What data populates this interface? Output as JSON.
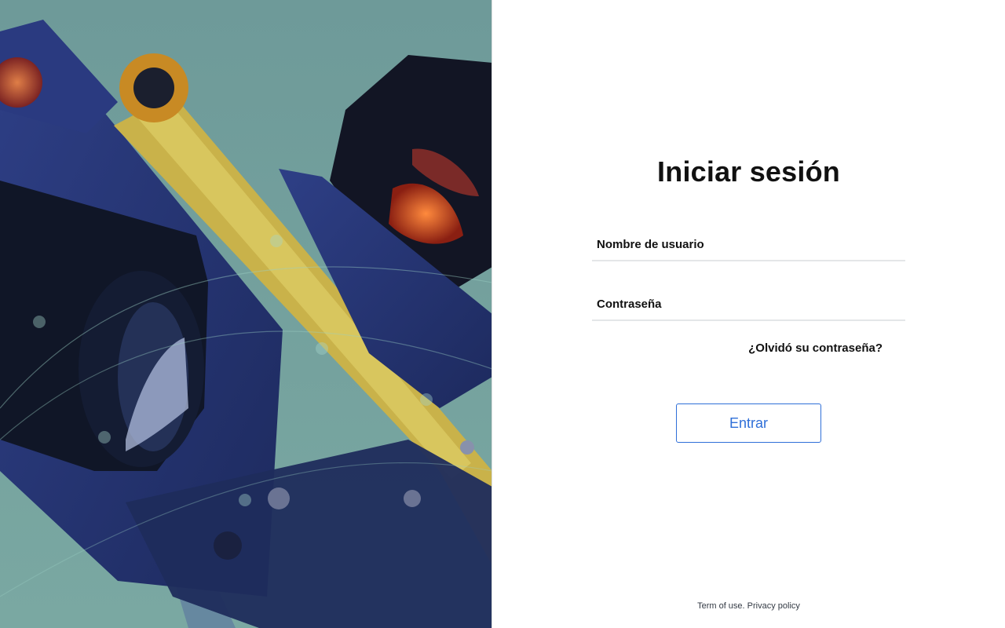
{
  "login": {
    "title": "Iniciar sesión",
    "username_placeholder": "Nombre de usuario",
    "password_placeholder": "Contraseña",
    "forgot_password": "¿Olvidó su contraseña?",
    "submit_label": "Entrar"
  },
  "footer": {
    "terms": "Term of use.",
    "privacy": "Privacy policy"
  },
  "colors": {
    "accent": "#2f6fd8",
    "text": "#111111",
    "field_underline": "#e4e6e8"
  }
}
